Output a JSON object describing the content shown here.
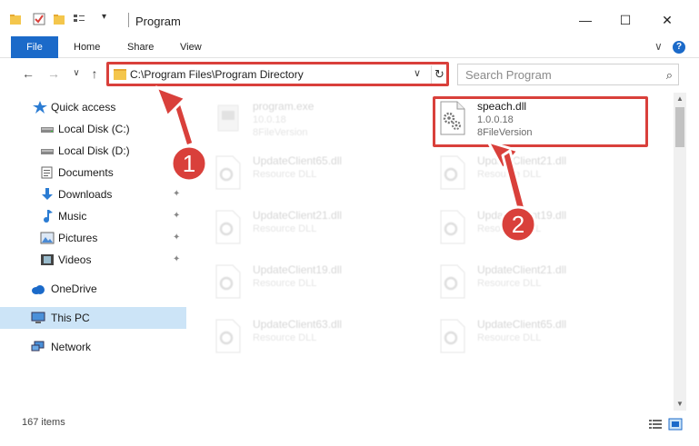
{
  "window": {
    "title": "Program",
    "minimize": "—",
    "maximize": "☐",
    "close": "✕"
  },
  "ribbon": {
    "tabs": [
      "File",
      "Home",
      "Share",
      "View"
    ],
    "expand_glyph": "∨",
    "help_glyph": "?"
  },
  "navigation": {
    "back": "←",
    "forward": "→",
    "recent": "∨",
    "up": "↑"
  },
  "address": {
    "path": "C:\\Program Files\\Program Directory",
    "chevron": "∨",
    "refresh": "↻"
  },
  "search": {
    "placeholder": "Search Program",
    "icon_glyph": "⌕"
  },
  "sidebar": {
    "items": [
      {
        "label": "Quick access",
        "icon": "star-icon",
        "pinned": false
      },
      {
        "label": "Local Disk (C:)",
        "icon": "drive-icon",
        "pinned": false
      },
      {
        "label": "Local Disk (D:)",
        "icon": "drive-icon",
        "pinned": false
      },
      {
        "label": "Documents",
        "icon": "documents-icon",
        "pinned": true
      },
      {
        "label": "Downloads",
        "icon": "download-icon",
        "pinned": true
      },
      {
        "label": "Music",
        "icon": "music-icon",
        "pinned": true
      },
      {
        "label": "Pictures",
        "icon": "pictures-icon",
        "pinned": true
      },
      {
        "label": "Videos",
        "icon": "videos-icon",
        "pinned": true
      },
      {
        "label": "OneDrive",
        "icon": "cloud-icon",
        "pinned": false
      },
      {
        "label": "This PC",
        "icon": "computer-icon",
        "pinned": false,
        "selected": true
      },
      {
        "label": "Network",
        "icon": "network-icon",
        "pinned": false
      }
    ],
    "pin_glyph": "📌"
  },
  "files": [
    {
      "name": "program.exe",
      "line1": "10.0.18",
      "line2": "8FileVersion",
      "kind": "exe",
      "faded": true
    },
    {
      "name": "speach.dll",
      "line1": "1.0.0.18",
      "line2": "8FileVersion",
      "kind": "dll",
      "faded": false,
      "highlighted": true
    },
    {
      "name": "UpdateClient65.dll",
      "line1": "Resource DLL",
      "line2": "",
      "kind": "dll",
      "faded": true
    },
    {
      "name": "UpdateClient21.dll",
      "line1": "Resource DLL",
      "line2": "",
      "kind": "dll",
      "faded": true
    },
    {
      "name": "UpdateClient21.dll",
      "line1": "Resource DLL",
      "line2": "",
      "kind": "dll",
      "faded": true
    },
    {
      "name": "UpdateClient19.dll",
      "line1": "Resource DLL",
      "line2": "",
      "kind": "dll",
      "faded": true
    },
    {
      "name": "UpdateClient19.dll",
      "line1": "Resource DLL",
      "line2": "",
      "kind": "dll",
      "faded": true
    },
    {
      "name": "UpdateClient21.dll",
      "line1": "Resource DLL",
      "line2": "",
      "kind": "dll",
      "faded": true
    },
    {
      "name": "UpdateClient63.dll",
      "line1": "Resource DLL",
      "line2": "",
      "kind": "dll",
      "faded": true
    },
    {
      "name": "UpdateClient65.dll",
      "line1": "Resource DLL",
      "line2": "",
      "kind": "dll",
      "faded": true
    }
  ],
  "annotations": {
    "badge1": "1",
    "badge2": "2",
    "color": "#d9403b"
  },
  "status": {
    "item_count": "167 items"
  },
  "colors": {
    "accent": "#1b6ac9",
    "selected": "#cce4f7",
    "folder": "#f4c64c"
  }
}
